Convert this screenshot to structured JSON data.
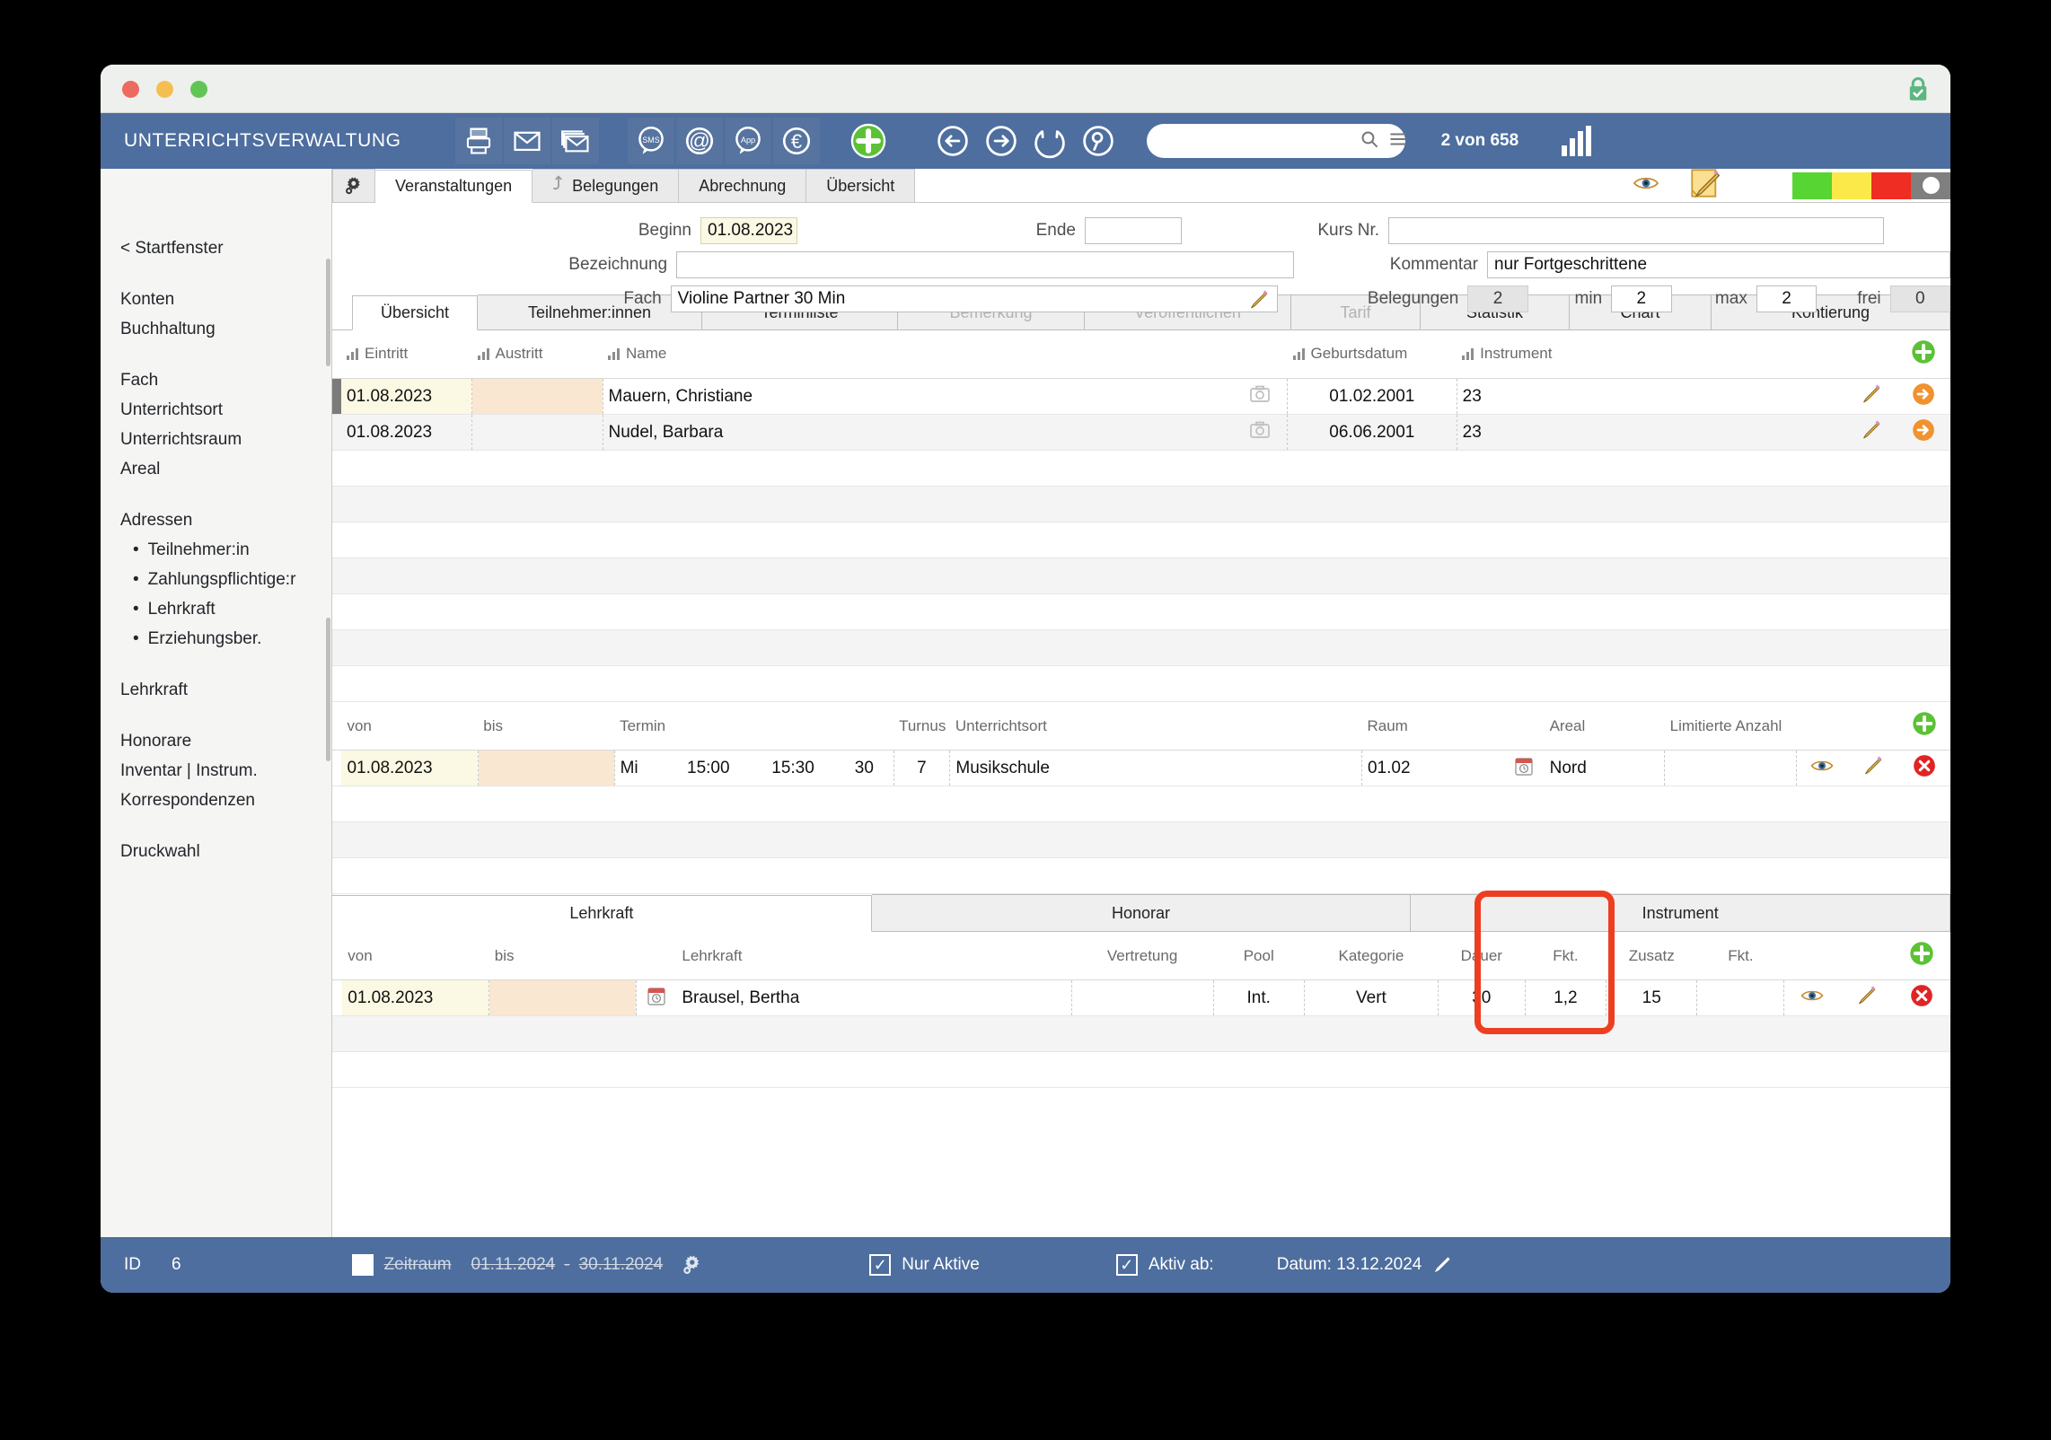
{
  "window": {
    "traffic_lights": [
      "close",
      "minimize",
      "maximize"
    ],
    "lock_icon": "lock-check-icon"
  },
  "toolbar": {
    "app_title": "UNTERRICHTSVERWALTUNG",
    "icons": [
      {
        "name": "printer-icon"
      },
      {
        "name": "mail-icon"
      },
      {
        "name": "mail-stack-icon"
      },
      {
        "name": "sms-bubble-icon",
        "label": "SMS"
      },
      {
        "name": "at-sign-icon",
        "label": "@"
      },
      {
        "name": "app-bubble-icon",
        "label": "App"
      },
      {
        "name": "euro-icon",
        "label": "€"
      },
      {
        "name": "add-plus-icon"
      },
      {
        "name": "back-arrow-icon"
      },
      {
        "name": "forward-arrow-icon"
      },
      {
        "name": "refresh-icon"
      },
      {
        "name": "search-person-icon"
      }
    ],
    "search_value": "",
    "search_placeholder": "",
    "record_count": "2 von 658",
    "signal_icon": "signal-bars-icon"
  },
  "sidebar": {
    "back_label": "< Startfenster",
    "groups": [
      {
        "items": [
          {
            "label": "Konten"
          },
          {
            "label": "Buchhaltung"
          }
        ]
      },
      {
        "items": [
          {
            "label": "Fach"
          },
          {
            "label": "Unterrichtsort"
          },
          {
            "label": "Unterrichtsraum"
          },
          {
            "label": "Areal"
          }
        ]
      },
      {
        "items": [
          {
            "label": "Adressen"
          }
        ]
      },
      {
        "items": [
          {
            "label": "Lehrkraft"
          }
        ]
      },
      {
        "items": [
          {
            "label": "Honorare"
          },
          {
            "label": "Inventar | Instrum."
          },
          {
            "label": "Korrespondenzen"
          }
        ]
      },
      {
        "items": [
          {
            "label": "Druckwahl"
          }
        ]
      }
    ],
    "adressen_sub": [
      {
        "label": "Teilnehmer:in"
      },
      {
        "label": "Zahlungspflichtige:r"
      },
      {
        "label": "Lehrkraft"
      },
      {
        "label": "Erziehungsber."
      }
    ]
  },
  "top_tabs": {
    "gear_icon": "gear-icon",
    "items": [
      {
        "label": "Veranstaltungen",
        "active": true,
        "icon": null
      },
      {
        "label": "Belegungen",
        "active": false,
        "icon": "hook-icon"
      },
      {
        "label": "Abrechnung",
        "active": false,
        "icon": null
      },
      {
        "label": "Übersicht",
        "active": false,
        "icon": null
      }
    ],
    "eye_icon": "eye-icon",
    "note_icon": "note-edit-icon",
    "swatches": [
      {
        "name": "status-green",
        "color": "#57d532"
      },
      {
        "name": "status-yellow",
        "color": "#fbe94a"
      },
      {
        "name": "status-red",
        "color": "#ef2d22"
      },
      {
        "name": "status-gray",
        "color": "#7f7f7f"
      }
    ]
  },
  "header_form": {
    "beginn_label": "Beginn",
    "beginn_value": "01.08.2023",
    "ende_label": "Ende",
    "ende_value": "",
    "bezeichnung_label": "Bezeichnung",
    "bezeichnung_value": "",
    "fach_label": "Fach",
    "fach_value": "Violine Partner 30 Min",
    "fach_edit_icon": "pencil-icon",
    "kursnr_label": "Kurs Nr.",
    "kursnr_value": "",
    "kommentar_label": "Kommentar",
    "kommentar_value": "nur Fortgeschrittene",
    "belegungen_label": "Belegungen",
    "belegungen_value": "2",
    "min_label": "min",
    "min_value": "2",
    "max_label": "max",
    "max_value": "2",
    "frei_label": "frei",
    "frei_value": "0"
  },
  "sub_tabs": [
    {
      "label": "Übersicht",
      "active": true,
      "disabled": false
    },
    {
      "label": "Teilnehmer:innen",
      "active": false,
      "disabled": false
    },
    {
      "label": "Terminliste",
      "active": false,
      "disabled": false
    },
    {
      "label": "Bemerkung",
      "active": false,
      "disabled": true
    },
    {
      "label": "Veröffentlichen",
      "active": false,
      "disabled": true
    },
    {
      "label": "Tarif",
      "active": false,
      "disabled": true
    },
    {
      "label": "Statistik",
      "active": false,
      "disabled": false
    },
    {
      "label": "Chart",
      "active": false,
      "disabled": false
    },
    {
      "label": "Kontierung",
      "active": false,
      "disabled": false
    }
  ],
  "participants": {
    "add_icon": "add-row-icon",
    "columns": [
      {
        "label": "Eintritt",
        "sort_icon": "sort-bars-icon"
      },
      {
        "label": "Austritt",
        "sort_icon": "sort-bars-icon"
      },
      {
        "label": "Name",
        "sort_icon": "sort-bars-icon"
      },
      {
        "label": "Geburtsdatum",
        "sort_icon": "sort-bars-icon"
      },
      {
        "label": "Instrument",
        "sort_icon": "sort-bars-icon"
      }
    ],
    "rows": [
      {
        "eintritt": "01.08.2023",
        "austritt": "",
        "name": "Mauern, Christiane",
        "photo_icon": "camera-icon",
        "geburtsdatum": "01.02.2001",
        "instrument": "23",
        "edit_icon": "pencil-icon",
        "go_icon": "arrow-circle-icon"
      },
      {
        "eintritt": "01.08.2023",
        "austritt": "",
        "name": "Nudel, Barbara",
        "photo_icon": "camera-icon",
        "geburtsdatum": "06.06.2001",
        "instrument": "23",
        "edit_icon": "pencil-icon",
        "go_icon": "arrow-circle-icon"
      }
    ]
  },
  "appointments": {
    "add_icon": "add-row-icon",
    "columns": [
      "von",
      "bis",
      "Termin",
      "Turnus",
      "Unterrichtsort",
      "Raum",
      "Areal",
      "Limitierte Anzahl"
    ],
    "rows": [
      {
        "von": "01.08.2023",
        "bis": "",
        "tag": "Mi",
        "zeit_von": "15:00",
        "zeit_bis": "15:30",
        "dauer": "30",
        "turnus": "7",
        "unterrichtsort": "Musikschule",
        "raum": "01.02",
        "areal_icon": "calendar-icon",
        "areal": "Nord",
        "limitierte_anzahl": "",
        "view_icon": "eye-icon",
        "edit_icon": "pencil-icon",
        "delete_icon": "delete-circle-icon"
      }
    ]
  },
  "bottom_tabs": [
    {
      "label": "Lehrkraft",
      "active": true
    },
    {
      "label": "Honorar",
      "active": false
    },
    {
      "label": "Instrument",
      "active": false
    }
  ],
  "teachers": {
    "add_icon": "add-row-icon",
    "columns": [
      "von",
      "bis",
      "Lehrkraft",
      "Vertretung",
      "Pool",
      "Kategorie",
      "Dauer",
      "Fkt.",
      "Zusatz",
      "Fkt."
    ],
    "rows": [
      {
        "von": "01.08.2023",
        "bis": "",
        "teacher_icon": "calendar-icon",
        "lehrkraft": "Brausel, Bertha",
        "vertretung": "",
        "pool": "Int.",
        "kategorie": "Vert",
        "dauer": "30",
        "fkt1": "1,2",
        "zusatz": "15",
        "fkt2": "",
        "view_icon": "eye-icon",
        "edit_icon": "pencil-icon",
        "delete_icon": "delete-circle-icon"
      }
    ]
  },
  "annotation": {
    "highlight_color": "#ee3e21",
    "highlight_target": "fkt-zusatz-columns"
  },
  "statusbar": {
    "id_label": "ID",
    "id_value": "6",
    "zeitraum_checkbox": false,
    "zeitraum_label": "Zeitraum",
    "zeitraum_from": "01.11.2024",
    "zeitraum_dash": "-",
    "zeitraum_to": "30.11.2024",
    "gear_icon": "gear-icon",
    "nur_aktive_checked": true,
    "nur_aktive_label": "Nur Aktive",
    "aktiv_ab_checked": true,
    "aktiv_ab_label": "Aktiv ab:",
    "datum_label": "Datum: 13.12.2024",
    "datum_edit_icon": "pencil-icon"
  }
}
